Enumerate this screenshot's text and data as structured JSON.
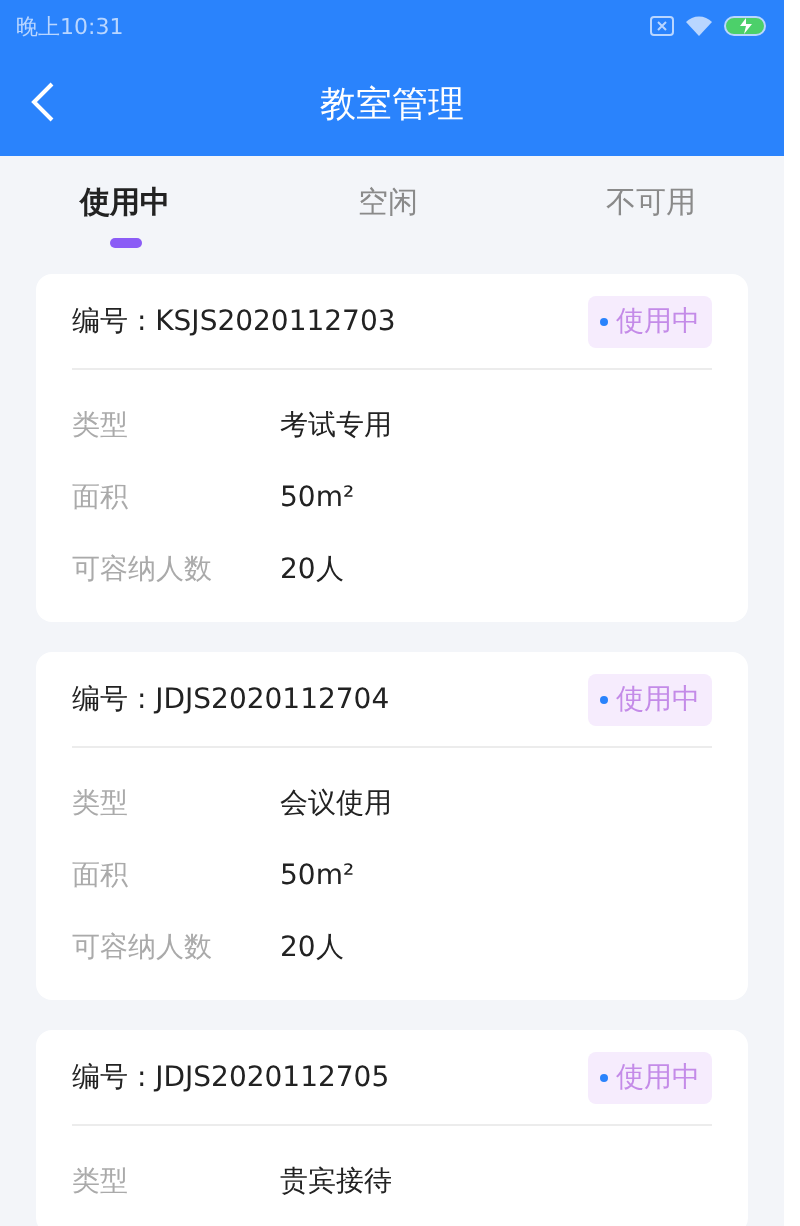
{
  "status_bar": {
    "time": "晚上10:31"
  },
  "header": {
    "title": "教室管理"
  },
  "tabs": [
    {
      "label": "使用中",
      "selected": true
    },
    {
      "label": "空闲",
      "selected": false
    },
    {
      "label": "不可用",
      "selected": false
    }
  ],
  "rooms": [
    {
      "code": "编号 : KSJS2020112703",
      "status": "使用中",
      "fields": [
        {
          "label": "类型",
          "value": "考试专用"
        },
        {
          "label": "面积",
          "value": "50m²"
        },
        {
          "label": "可容纳人数",
          "value": "20人"
        }
      ]
    },
    {
      "code": "编号 : JDJS2020112704",
      "status": "使用中",
      "fields": [
        {
          "label": "类型",
          "value": "会议使用"
        },
        {
          "label": "面积",
          "value": "50m²"
        },
        {
          "label": "可容纳人数",
          "value": "20人"
        }
      ]
    },
    {
      "code": "编号 : JDJS2020112705",
      "status": "使用中",
      "fields": [
        {
          "label": "类型",
          "value": "贵宾接待"
        }
      ]
    }
  ]
}
